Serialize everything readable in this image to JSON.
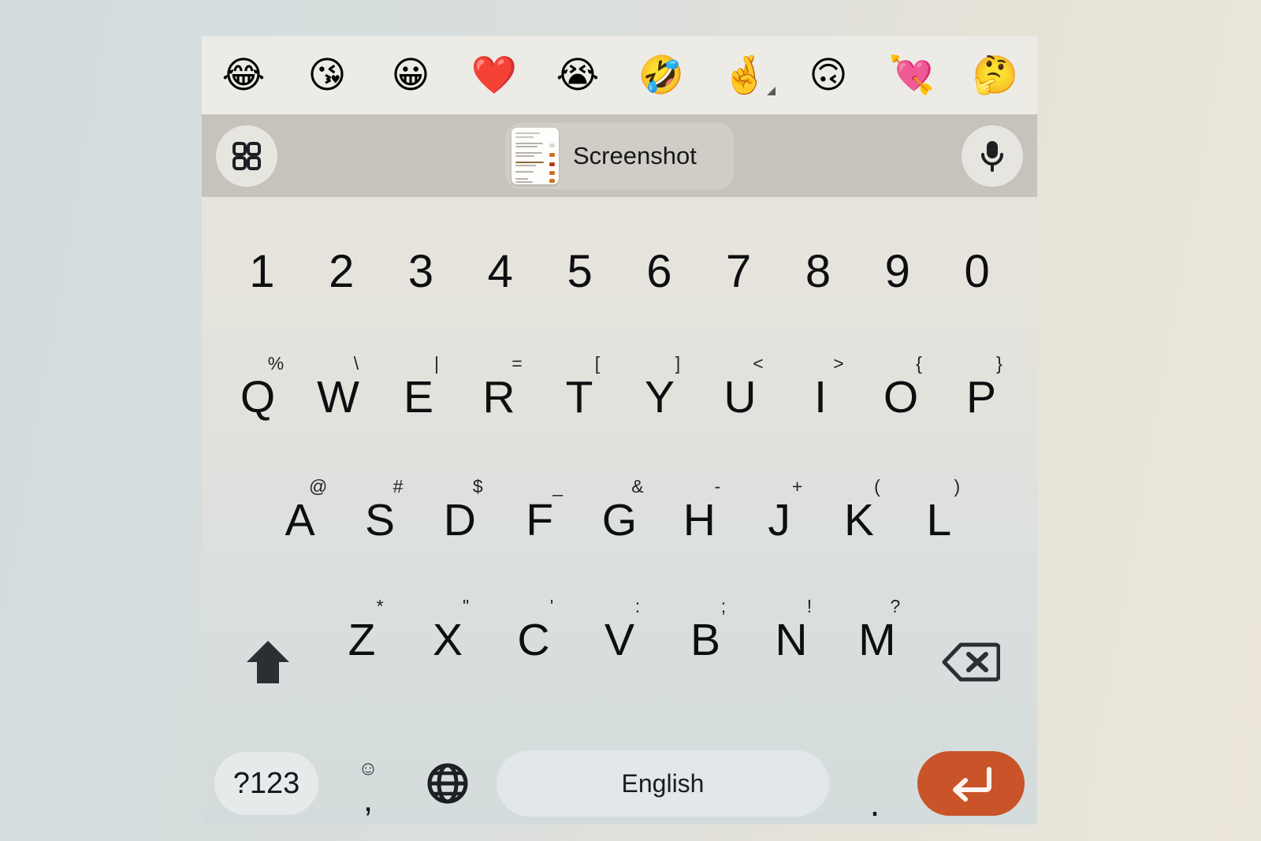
{
  "app": {
    "name": "Android on-screen keyboard (Gboard)",
    "keyboard_bg_top": "#e9e5dd",
    "keyboard_bg_bottom": "#d3dcdc",
    "enter_key_color": "#c9542a",
    "toolbar_bg": "#c7c3bc",
    "emoji_strip_bg": "#ecebe6"
  },
  "emoji_strip": {
    "items": [
      {
        "glyph": "😂",
        "name": "face-with-tears-of-joy",
        "has_variant_indicator": false
      },
      {
        "glyph": "😘",
        "name": "face-blowing-a-kiss",
        "has_variant_indicator": false
      },
      {
        "glyph": "😀",
        "name": "grinning-face",
        "has_variant_indicator": false
      },
      {
        "glyph": "❤️",
        "name": "red-heart",
        "has_variant_indicator": false
      },
      {
        "glyph": "😭",
        "name": "loudly-crying-face",
        "has_variant_indicator": false
      },
      {
        "glyph": "🤣",
        "name": "rolling-on-the-floor-laughing",
        "has_variant_indicator": false
      },
      {
        "glyph": "🤞",
        "name": "crossed-fingers",
        "has_variant_indicator": true
      },
      {
        "glyph": "🙃",
        "name": "upside-down-face",
        "has_variant_indicator": false
      },
      {
        "glyph": "💘",
        "name": "heart-with-arrow",
        "has_variant_indicator": false
      },
      {
        "glyph": "🤔",
        "name": "thinking-face",
        "has_variant_indicator": false
      }
    ]
  },
  "toolbar": {
    "grid_icon": "apps-grid-icon",
    "mic_icon": "microphone-icon",
    "clipboard_chip": {
      "label": "Screenshot",
      "thumbnail": "screenshot-thumbnail"
    }
  },
  "keyboard": {
    "number_row": [
      {
        "main": "1"
      },
      {
        "main": "2"
      },
      {
        "main": "3"
      },
      {
        "main": "4"
      },
      {
        "main": "5"
      },
      {
        "main": "6"
      },
      {
        "main": "7"
      },
      {
        "main": "8"
      },
      {
        "main": "9"
      },
      {
        "main": "0"
      }
    ],
    "row_qwerty": [
      {
        "main": "Q",
        "sup": "%"
      },
      {
        "main": "W",
        "sup": "\\"
      },
      {
        "main": "E",
        "sup": "|"
      },
      {
        "main": "R",
        "sup": "="
      },
      {
        "main": "T",
        "sup": "["
      },
      {
        "main": "Y",
        "sup": "]"
      },
      {
        "main": "U",
        "sup": "<"
      },
      {
        "main": "I",
        "sup": ">"
      },
      {
        "main": "O",
        "sup": "{"
      },
      {
        "main": "P",
        "sup": "}"
      }
    ],
    "row_asdf": [
      {
        "main": "A",
        "sup": "@"
      },
      {
        "main": "S",
        "sup": "#"
      },
      {
        "main": "D",
        "sup": "$"
      },
      {
        "main": "F",
        "sup": "_"
      },
      {
        "main": "G",
        "sup": "&"
      },
      {
        "main": "H",
        "sup": "-"
      },
      {
        "main": "J",
        "sup": "+"
      },
      {
        "main": "K",
        "sup": "("
      },
      {
        "main": "L",
        "sup": ")"
      }
    ],
    "row_zxcv": [
      {
        "main": "Z",
        "sup": "*"
      },
      {
        "main": "X",
        "sup": "\""
      },
      {
        "main": "C",
        "sup": "'"
      },
      {
        "main": "V",
        "sup": ":"
      },
      {
        "main": "B",
        "sup": ";"
      },
      {
        "main": "N",
        "sup": "!"
      },
      {
        "main": "M",
        "sup": "?"
      }
    ],
    "shift_key": "shift-icon",
    "backspace_key": "backspace-icon",
    "bottom_row": {
      "symbols_label": "?123",
      "emoji_icon": "smiley-face-icon",
      "comma_label": ",",
      "globe_icon": "globe-language-icon",
      "space_label": "English",
      "period_label": ".",
      "enter_icon": "enter-return-icon"
    }
  }
}
